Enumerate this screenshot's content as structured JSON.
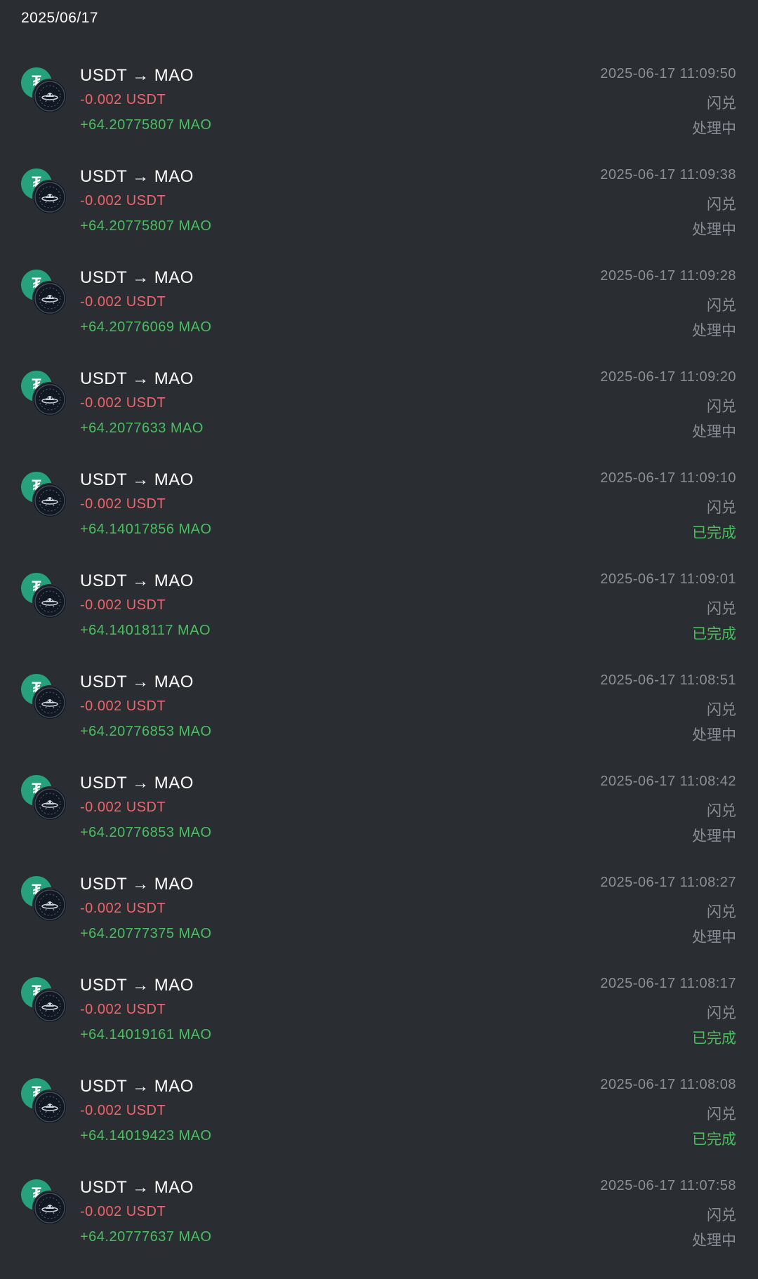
{
  "header": {
    "date": "2025/06/17"
  },
  "colors": {
    "background": "#2a2e32",
    "negative": "#f0646a",
    "positive": "#46c05d",
    "muted": "#8a8f95",
    "usdt_brand": "#26a17b"
  },
  "icons": {
    "from_token": "usdt-icon",
    "to_token": "mao-icon"
  },
  "transactions": [
    {
      "pair": "USDT → MAO",
      "sent": "-0.002 USDT",
      "received": "+64.20775807 MAO",
      "timestamp": "2025-06-17 11:09:50",
      "type": "闪兑",
      "status": "处理中",
      "status_kind": "processing"
    },
    {
      "pair": "USDT → MAO",
      "sent": "-0.002 USDT",
      "received": "+64.20775807 MAO",
      "timestamp": "2025-06-17 11:09:38",
      "type": "闪兑",
      "status": "处理中",
      "status_kind": "processing"
    },
    {
      "pair": "USDT → MAO",
      "sent": "-0.002 USDT",
      "received": "+64.20776069 MAO",
      "timestamp": "2025-06-17 11:09:28",
      "type": "闪兑",
      "status": "处理中",
      "status_kind": "processing"
    },
    {
      "pair": "USDT → MAO",
      "sent": "-0.002 USDT",
      "received": "+64.2077633 MAO",
      "timestamp": "2025-06-17 11:09:20",
      "type": "闪兑",
      "status": "处理中",
      "status_kind": "processing"
    },
    {
      "pair": "USDT → MAO",
      "sent": "-0.002 USDT",
      "received": "+64.14017856 MAO",
      "timestamp": "2025-06-17 11:09:10",
      "type": "闪兑",
      "status": "已完成",
      "status_kind": "done"
    },
    {
      "pair": "USDT → MAO",
      "sent": "-0.002 USDT",
      "received": "+64.14018117 MAO",
      "timestamp": "2025-06-17 11:09:01",
      "type": "闪兑",
      "status": "已完成",
      "status_kind": "done"
    },
    {
      "pair": "USDT → MAO",
      "sent": "-0.002 USDT",
      "received": "+64.20776853 MAO",
      "timestamp": "2025-06-17 11:08:51",
      "type": "闪兑",
      "status": "处理中",
      "status_kind": "processing"
    },
    {
      "pair": "USDT → MAO",
      "sent": "-0.002 USDT",
      "received": "+64.20776853 MAO",
      "timestamp": "2025-06-17 11:08:42",
      "type": "闪兑",
      "status": "处理中",
      "status_kind": "processing"
    },
    {
      "pair": "USDT → MAO",
      "sent": "-0.002 USDT",
      "received": "+64.20777375 MAO",
      "timestamp": "2025-06-17 11:08:27",
      "type": "闪兑",
      "status": "处理中",
      "status_kind": "processing"
    },
    {
      "pair": "USDT → MAO",
      "sent": "-0.002 USDT",
      "received": "+64.14019161 MAO",
      "timestamp": "2025-06-17 11:08:17",
      "type": "闪兑",
      "status": "已完成",
      "status_kind": "done"
    },
    {
      "pair": "USDT → MAO",
      "sent": "-0.002 USDT",
      "received": "+64.14019423 MAO",
      "timestamp": "2025-06-17 11:08:08",
      "type": "闪兑",
      "status": "已完成",
      "status_kind": "done"
    },
    {
      "pair": "USDT → MAO",
      "sent": "-0.002 USDT",
      "received": "+64.20777637 MAO",
      "timestamp": "2025-06-17 11:07:58",
      "type": "闪兑",
      "status": "处理中",
      "status_kind": "processing"
    }
  ]
}
